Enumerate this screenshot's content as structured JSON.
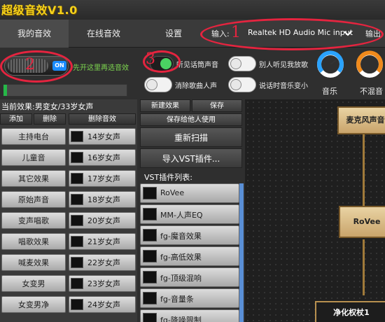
{
  "app": {
    "title": "超级音效V1.0"
  },
  "tabs": [
    {
      "label": "我的音效",
      "active": true
    },
    {
      "label": "在线音效",
      "active": false
    },
    {
      "label": "设置",
      "active": false
    }
  ],
  "io": {
    "input_label": "输入:",
    "input_device": "Realtek HD Audio Mic input",
    "output_label": "输出:"
  },
  "main_switch": {
    "state_label": "ON",
    "hint": "先开这里再选音效"
  },
  "level_meter": {
    "fraction": 0.03
  },
  "toggles": [
    {
      "label": "听见话筒声音",
      "on": true
    },
    {
      "label": "别人听见我放歌",
      "on": false
    },
    {
      "label": "消除歌曲人声",
      "on": false
    },
    {
      "label": "说话时音乐变小",
      "on": false
    }
  ],
  "knobs": [
    {
      "label": "音乐",
      "color": "#2aa3ff"
    },
    {
      "label": "不混音",
      "color": "#f08a1c"
    }
  ],
  "annotations": [
    "1",
    "2",
    "3"
  ],
  "left_panel": {
    "current_effect": "当前效果:男变女/33岁女声",
    "add_label": "添加",
    "delete_label": "删除",
    "delete_effect_label": "删除音效",
    "presets": [
      {
        "name": "主持电台",
        "female": "14岁女声"
      },
      {
        "name": "儿童音",
        "female": "16岁女声"
      },
      {
        "name": "其它效果",
        "female": "17岁女声"
      },
      {
        "name": "原始声音",
        "female": "18岁女声"
      },
      {
        "name": "变声唱歌",
        "female": "20岁女声"
      },
      {
        "name": "唱歌效果",
        "female": "21岁女声"
      },
      {
        "name": "喊麦效果",
        "female": "22岁女声"
      },
      {
        "name": "女变男",
        "female": "23岁女声"
      },
      {
        "name": "女变男净",
        "female": "24岁女声"
      }
    ]
  },
  "mid_panel": {
    "new_effect": "新建效果",
    "save": "保存",
    "save_for_others": "保存给他人使用",
    "rescan": "重新扫描",
    "import_vst": "导入VST插件...",
    "vst_list_label": "VST插件列表:",
    "vst_plugins": [
      "RoVee",
      "MM-人声EQ",
      "fg-魔音效果",
      "fg-高低效果",
      "fg-顶级混响",
      "fg-音量条",
      "fg-降噪限制"
    ]
  },
  "graph": {
    "nodes": [
      {
        "label": "麦克风声音"
      },
      {
        "label": "RoVee"
      },
      {
        "label": "净化权杖1"
      }
    ]
  }
}
